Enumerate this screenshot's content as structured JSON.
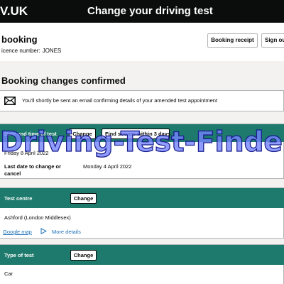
{
  "header": {
    "logo_text": "V.UK",
    "service_name": "Change your driving test"
  },
  "booking": {
    "title": "booking",
    "licence_label": "icence number:",
    "licence_value": "JONES",
    "receipt_button": "Booking receipt",
    "signout_button": "Sign ou"
  },
  "confirmation": {
    "heading": "Booking changes confirmed",
    "message": "You'll shortly be sent an email confirming details of your amended test appointment",
    "icon": "envelope-icon"
  },
  "date_panel": {
    "label": "Date and time of test",
    "change_button": "Change",
    "find_button": "Find sooner within 3 days",
    "date_value": "Friday 8 April 2022",
    "last_date_label": "Last date to change or cancel",
    "last_date_value": "Monday 4 April 2022"
  },
  "centre_panel": {
    "label": "Test centre",
    "change_button": "Change",
    "value": "Ashford (London Middlesex)",
    "map_link": "Google map",
    "details_link": "More details"
  },
  "type_panel": {
    "label": "Type of test",
    "change_button": "Change",
    "value": "Car"
  },
  "watermark": "Driving-Test-Finder",
  "colors": {
    "header_bg": "#0b0c0c",
    "panel_head_bg": "#1d7a6c",
    "link": "#1d70b8",
    "page_bg": "#f3f2f1"
  }
}
